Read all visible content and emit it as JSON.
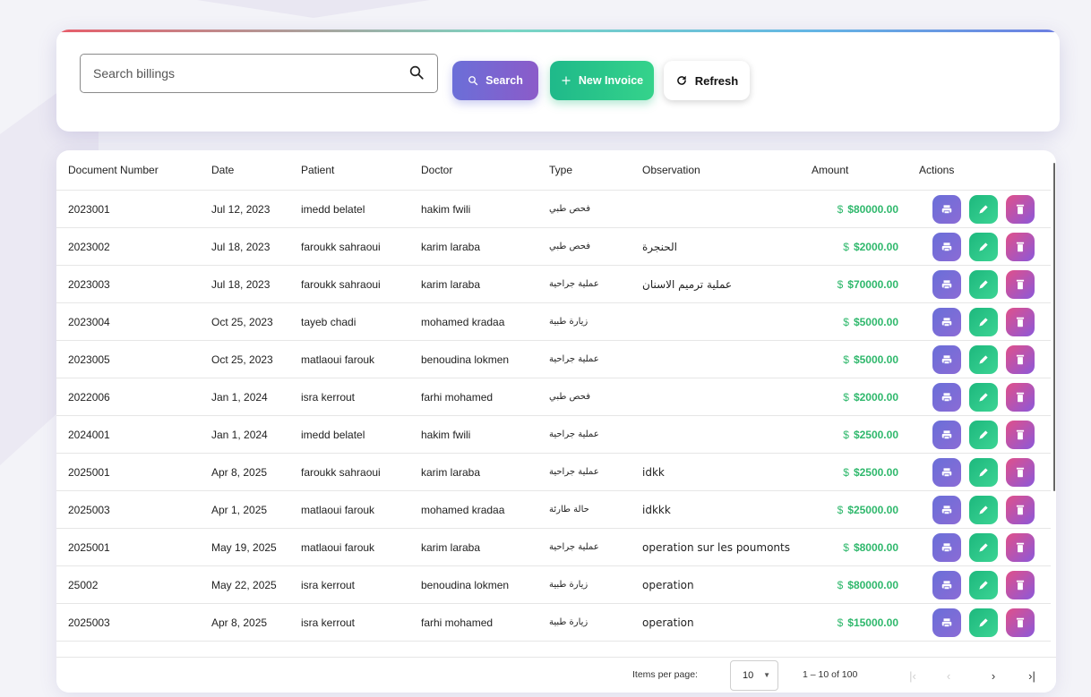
{
  "search": {
    "placeholder": "Search billings",
    "search_label": "Search",
    "new_invoice_label": "New Invoice",
    "refresh_label": "Refresh"
  },
  "table": {
    "headers": {
      "document_number": "Document Number",
      "date": "Date",
      "patient": "Patient",
      "doctor": "Doctor",
      "type": "Type",
      "observation": "Observation",
      "amount": "Amount",
      "actions": "Actions"
    },
    "currency": "$",
    "rows": [
      {
        "doc": "2023001",
        "date": "Jul 12, 2023",
        "patient": "imedd belatel",
        "doctor": "hakim fwili",
        "type": "فحص طبي",
        "observation": "",
        "amount": "$80000.00"
      },
      {
        "doc": "2023002",
        "date": "Jul 18, 2023",
        "patient": "faroukk sahraoui",
        "doctor": "karim laraba",
        "type": "فحص طبي",
        "observation": "الحنجرة",
        "amount": "$2000.00"
      },
      {
        "doc": "2023003",
        "date": "Jul 18, 2023",
        "patient": "faroukk sahraoui",
        "doctor": "karim laraba",
        "type": "عملية جراحية",
        "observation": "عملية ترميم الاسنان",
        "amount": "$70000.00"
      },
      {
        "doc": "2023004",
        "date": "Oct 25, 2023",
        "patient": "tayeb chadi",
        "doctor": "mohamed kradaa",
        "type": "زيارة طبية",
        "observation": "",
        "amount": "$5000.00"
      },
      {
        "doc": "2023005",
        "date": "Oct 25, 2023",
        "patient": "matlaoui farouk",
        "doctor": "benoudina lokmen",
        "type": "عملية جراحية",
        "observation": "",
        "amount": "$5000.00"
      },
      {
        "doc": "2022006",
        "date": "Jan 1, 2024",
        "patient": "isra kerrout",
        "doctor": "farhi mohamed",
        "type": "فحص طبي",
        "observation": "",
        "amount": "$2000.00"
      },
      {
        "doc": "2024001",
        "date": "Jan 1, 2024",
        "patient": "imedd belatel",
        "doctor": "hakim fwili",
        "type": "عملية جراحية",
        "observation": "",
        "amount": "$2500.00"
      },
      {
        "doc": "2025001",
        "date": "Apr 8, 2025",
        "patient": "faroukk sahraoui",
        "doctor": "karim laraba",
        "type": "عملية جراحية",
        "observation": "idkk",
        "amount": "$2500.00"
      },
      {
        "doc": "2025003",
        "date": "Apr 1, 2025",
        "patient": "matlaoui farouk",
        "doctor": "mohamed kradaa",
        "type": "حالة طارئة",
        "observation": "idkkk",
        "amount": "$25000.00"
      },
      {
        "doc": "2025001",
        "date": "May 19, 2025",
        "patient": "matlaoui farouk",
        "doctor": "karim laraba",
        "type": "عملية جراحية",
        "observation": "operation sur les poumonts",
        "amount": "$8000.00"
      },
      {
        "doc": "25002",
        "date": "May 22, 2025",
        "patient": "isra kerrout",
        "doctor": "benoudina lokmen",
        "type": "زيارة طبية",
        "observation": "operation",
        "amount": "$80000.00"
      },
      {
        "doc": "2025003",
        "date": "Apr 8, 2025",
        "patient": "isra kerrout",
        "doctor": "farhi mohamed",
        "type": "زيارة طبية",
        "observation": "operation",
        "amount": "$15000.00"
      }
    ]
  },
  "paginator": {
    "items_per_page_label": "Items per page:",
    "page_size": "10",
    "range_label": "1 – 10 of 100"
  },
  "icons": {
    "search": "search-icon",
    "plus": "plus-icon",
    "refresh": "refresh-icon",
    "print": "print-icon",
    "edit": "edit-icon",
    "delete": "delete-icon"
  },
  "colors": {
    "search_button": "#6b6fd8",
    "new_invoice_button": "#2fc788",
    "amount_text": "#2fb86c",
    "delete_button": "#c955a6"
  }
}
